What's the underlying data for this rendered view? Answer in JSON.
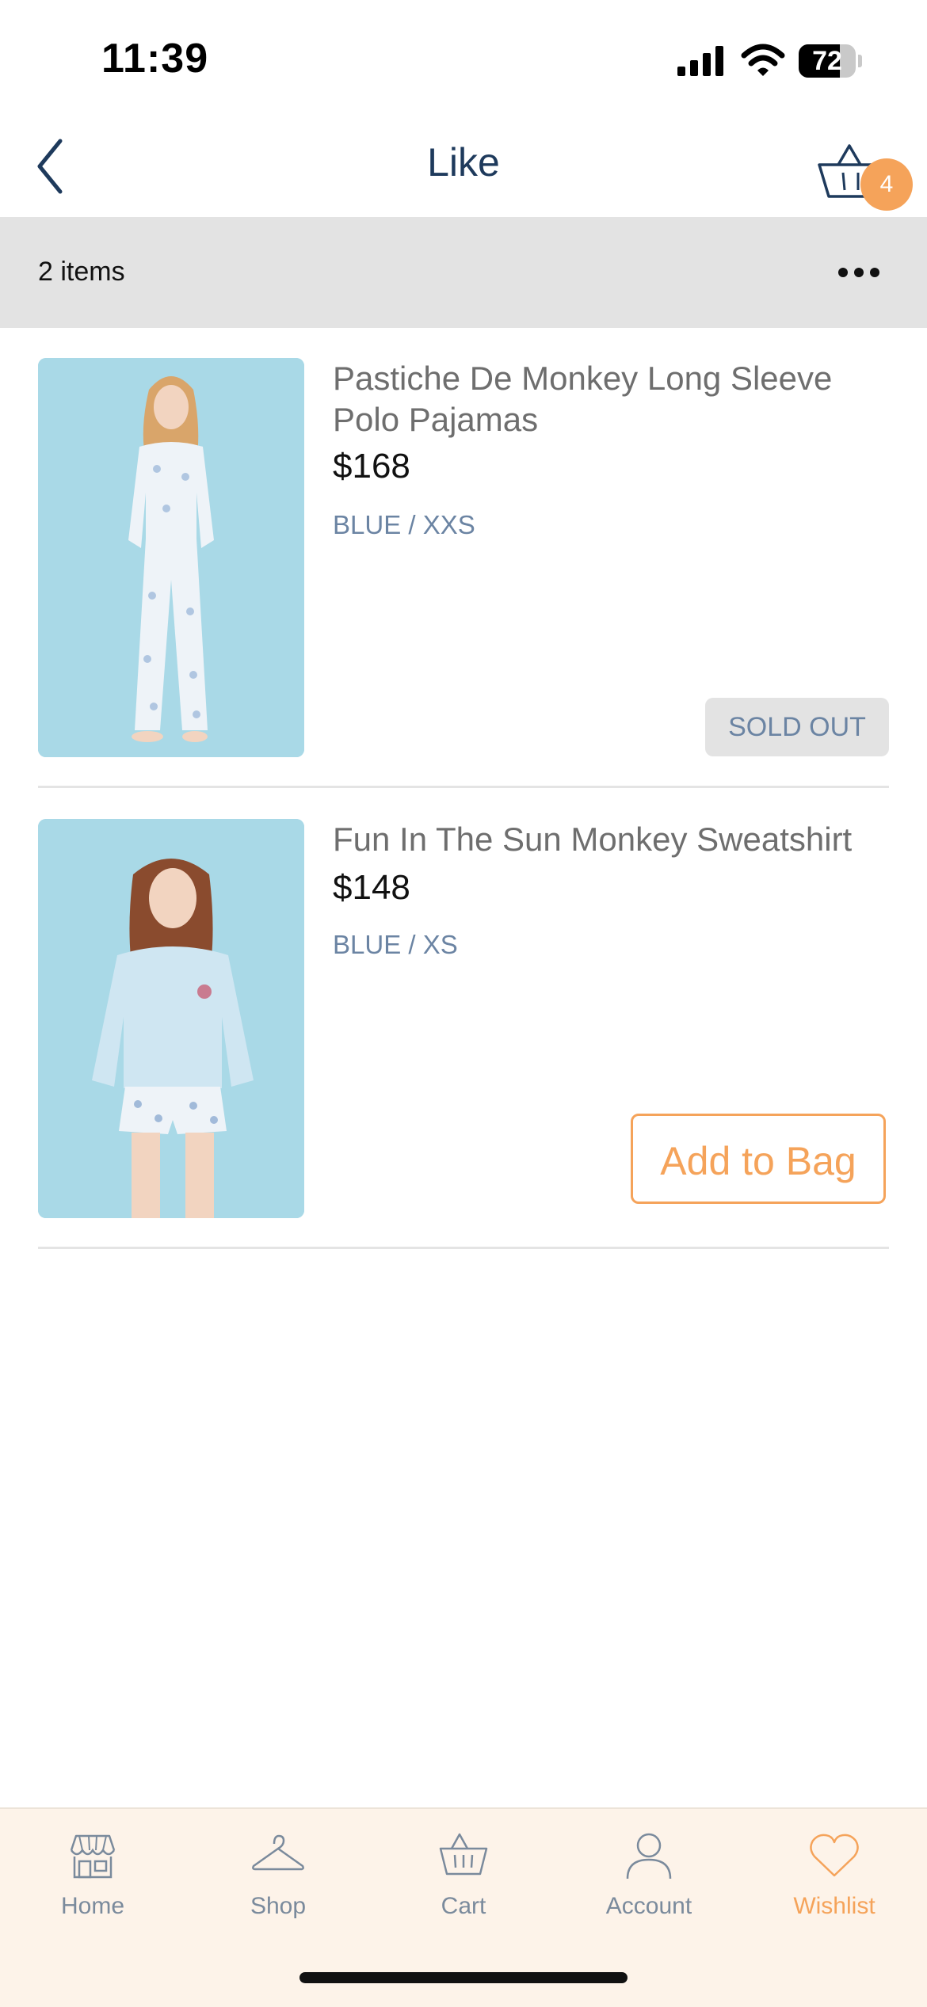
{
  "status": {
    "time": "11:39",
    "battery": "72",
    "battery_level": 0.72
  },
  "nav": {
    "title": "Like",
    "cart_badge": "4"
  },
  "items_bar": {
    "count_label": "2 items"
  },
  "products": [
    {
      "name": "Pastiche De Monkey Long Sleeve Polo Pajamas",
      "price": "$168",
      "variant": "BLUE / XXS",
      "status_label": "SOLD OUT"
    },
    {
      "name": "Fun In The Sun Monkey Sweatshirt",
      "price": "$148",
      "variant": "BLUE / XS",
      "action_label": "Add to Bag"
    }
  ],
  "tabs": [
    {
      "label": "Home",
      "icon": "store-icon"
    },
    {
      "label": "Shop",
      "icon": "hanger-icon"
    },
    {
      "label": "Cart",
      "icon": "basket-icon"
    },
    {
      "label": "Account",
      "icon": "person-icon"
    },
    {
      "label": "Wishlist",
      "icon": "heart-icon",
      "active": true
    }
  ],
  "colors": {
    "accent": "#f5a35a",
    "title": "#1e3a5c",
    "variant": "#6b84a3",
    "tab_bg": "#fdf3e9"
  }
}
